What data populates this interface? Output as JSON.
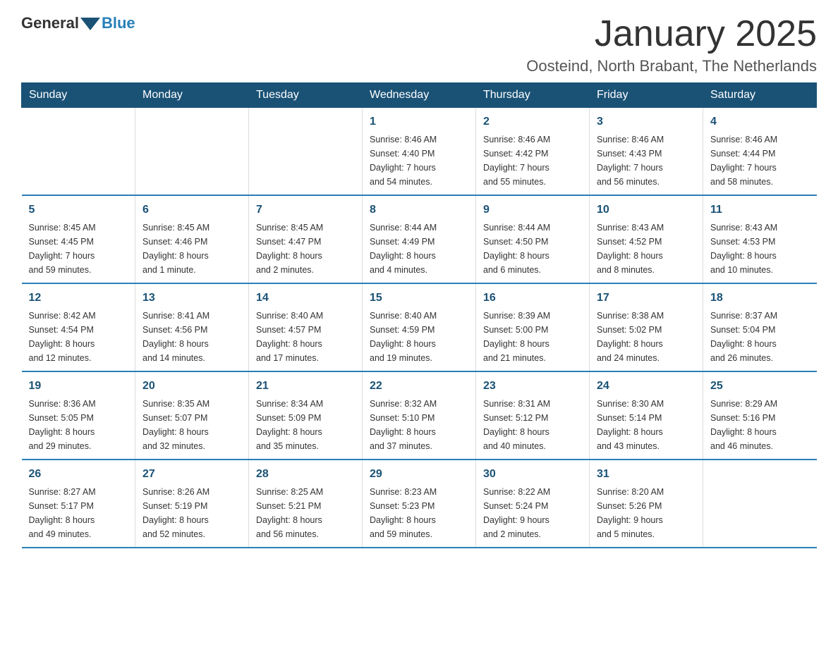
{
  "header": {
    "logo": {
      "general": "General",
      "blue": "Blue"
    },
    "title": "January 2025",
    "location": "Oosteind, North Brabant, The Netherlands"
  },
  "calendar": {
    "days_of_week": [
      "Sunday",
      "Monday",
      "Tuesday",
      "Wednesday",
      "Thursday",
      "Friday",
      "Saturday"
    ],
    "weeks": [
      [
        {
          "day": "",
          "info": ""
        },
        {
          "day": "",
          "info": ""
        },
        {
          "day": "",
          "info": ""
        },
        {
          "day": "1",
          "info": "Sunrise: 8:46 AM\nSunset: 4:40 PM\nDaylight: 7 hours\nand 54 minutes."
        },
        {
          "day": "2",
          "info": "Sunrise: 8:46 AM\nSunset: 4:42 PM\nDaylight: 7 hours\nand 55 minutes."
        },
        {
          "day": "3",
          "info": "Sunrise: 8:46 AM\nSunset: 4:43 PM\nDaylight: 7 hours\nand 56 minutes."
        },
        {
          "day": "4",
          "info": "Sunrise: 8:46 AM\nSunset: 4:44 PM\nDaylight: 7 hours\nand 58 minutes."
        }
      ],
      [
        {
          "day": "5",
          "info": "Sunrise: 8:45 AM\nSunset: 4:45 PM\nDaylight: 7 hours\nand 59 minutes."
        },
        {
          "day": "6",
          "info": "Sunrise: 8:45 AM\nSunset: 4:46 PM\nDaylight: 8 hours\nand 1 minute."
        },
        {
          "day": "7",
          "info": "Sunrise: 8:45 AM\nSunset: 4:47 PM\nDaylight: 8 hours\nand 2 minutes."
        },
        {
          "day": "8",
          "info": "Sunrise: 8:44 AM\nSunset: 4:49 PM\nDaylight: 8 hours\nand 4 minutes."
        },
        {
          "day": "9",
          "info": "Sunrise: 8:44 AM\nSunset: 4:50 PM\nDaylight: 8 hours\nand 6 minutes."
        },
        {
          "day": "10",
          "info": "Sunrise: 8:43 AM\nSunset: 4:52 PM\nDaylight: 8 hours\nand 8 minutes."
        },
        {
          "day": "11",
          "info": "Sunrise: 8:43 AM\nSunset: 4:53 PM\nDaylight: 8 hours\nand 10 minutes."
        }
      ],
      [
        {
          "day": "12",
          "info": "Sunrise: 8:42 AM\nSunset: 4:54 PM\nDaylight: 8 hours\nand 12 minutes."
        },
        {
          "day": "13",
          "info": "Sunrise: 8:41 AM\nSunset: 4:56 PM\nDaylight: 8 hours\nand 14 minutes."
        },
        {
          "day": "14",
          "info": "Sunrise: 8:40 AM\nSunset: 4:57 PM\nDaylight: 8 hours\nand 17 minutes."
        },
        {
          "day": "15",
          "info": "Sunrise: 8:40 AM\nSunset: 4:59 PM\nDaylight: 8 hours\nand 19 minutes."
        },
        {
          "day": "16",
          "info": "Sunrise: 8:39 AM\nSunset: 5:00 PM\nDaylight: 8 hours\nand 21 minutes."
        },
        {
          "day": "17",
          "info": "Sunrise: 8:38 AM\nSunset: 5:02 PM\nDaylight: 8 hours\nand 24 minutes."
        },
        {
          "day": "18",
          "info": "Sunrise: 8:37 AM\nSunset: 5:04 PM\nDaylight: 8 hours\nand 26 minutes."
        }
      ],
      [
        {
          "day": "19",
          "info": "Sunrise: 8:36 AM\nSunset: 5:05 PM\nDaylight: 8 hours\nand 29 minutes."
        },
        {
          "day": "20",
          "info": "Sunrise: 8:35 AM\nSunset: 5:07 PM\nDaylight: 8 hours\nand 32 minutes."
        },
        {
          "day": "21",
          "info": "Sunrise: 8:34 AM\nSunset: 5:09 PM\nDaylight: 8 hours\nand 35 minutes."
        },
        {
          "day": "22",
          "info": "Sunrise: 8:32 AM\nSunset: 5:10 PM\nDaylight: 8 hours\nand 37 minutes."
        },
        {
          "day": "23",
          "info": "Sunrise: 8:31 AM\nSunset: 5:12 PM\nDaylight: 8 hours\nand 40 minutes."
        },
        {
          "day": "24",
          "info": "Sunrise: 8:30 AM\nSunset: 5:14 PM\nDaylight: 8 hours\nand 43 minutes."
        },
        {
          "day": "25",
          "info": "Sunrise: 8:29 AM\nSunset: 5:16 PM\nDaylight: 8 hours\nand 46 minutes."
        }
      ],
      [
        {
          "day": "26",
          "info": "Sunrise: 8:27 AM\nSunset: 5:17 PM\nDaylight: 8 hours\nand 49 minutes."
        },
        {
          "day": "27",
          "info": "Sunrise: 8:26 AM\nSunset: 5:19 PM\nDaylight: 8 hours\nand 52 minutes."
        },
        {
          "day": "28",
          "info": "Sunrise: 8:25 AM\nSunset: 5:21 PM\nDaylight: 8 hours\nand 56 minutes."
        },
        {
          "day": "29",
          "info": "Sunrise: 8:23 AM\nSunset: 5:23 PM\nDaylight: 8 hours\nand 59 minutes."
        },
        {
          "day": "30",
          "info": "Sunrise: 8:22 AM\nSunset: 5:24 PM\nDaylight: 9 hours\nand 2 minutes."
        },
        {
          "day": "31",
          "info": "Sunrise: 8:20 AM\nSunset: 5:26 PM\nDaylight: 9 hours\nand 5 minutes."
        },
        {
          "day": "",
          "info": ""
        }
      ]
    ]
  }
}
